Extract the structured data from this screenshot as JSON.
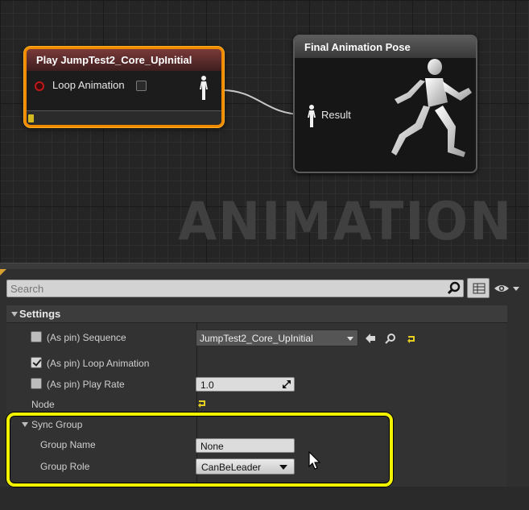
{
  "graph": {
    "watermark": "ANIMATION",
    "play_node": {
      "title": "Play JumpTest2_Core_UpInitial",
      "loop_label": "Loop Animation",
      "loop_checked": false,
      "playback_progress": 0.03,
      "accent_color": "#f08a00"
    },
    "final_node": {
      "title": "Final Animation Pose",
      "result_label": "Result"
    }
  },
  "details": {
    "search_placeholder": "Search",
    "section_title": "Settings",
    "sequence": {
      "label": "(As pin)  Sequence",
      "value": "JumpTest2_Core_UpInitial",
      "pin_checked": false
    },
    "loop_animation": {
      "label": "(As pin)  Loop Animation",
      "pin_checked": true
    },
    "play_rate": {
      "label": "(As pin)  Play Rate",
      "value": "1.0",
      "pin_checked": false
    },
    "node_label": "Node",
    "sync_group": {
      "title": "Sync Group",
      "group_name_label": "Group Name",
      "group_name_value": "None",
      "group_role_label": "Group Role",
      "group_role_value": "CanBeLeader"
    },
    "highlight_color": "#f2f200"
  }
}
